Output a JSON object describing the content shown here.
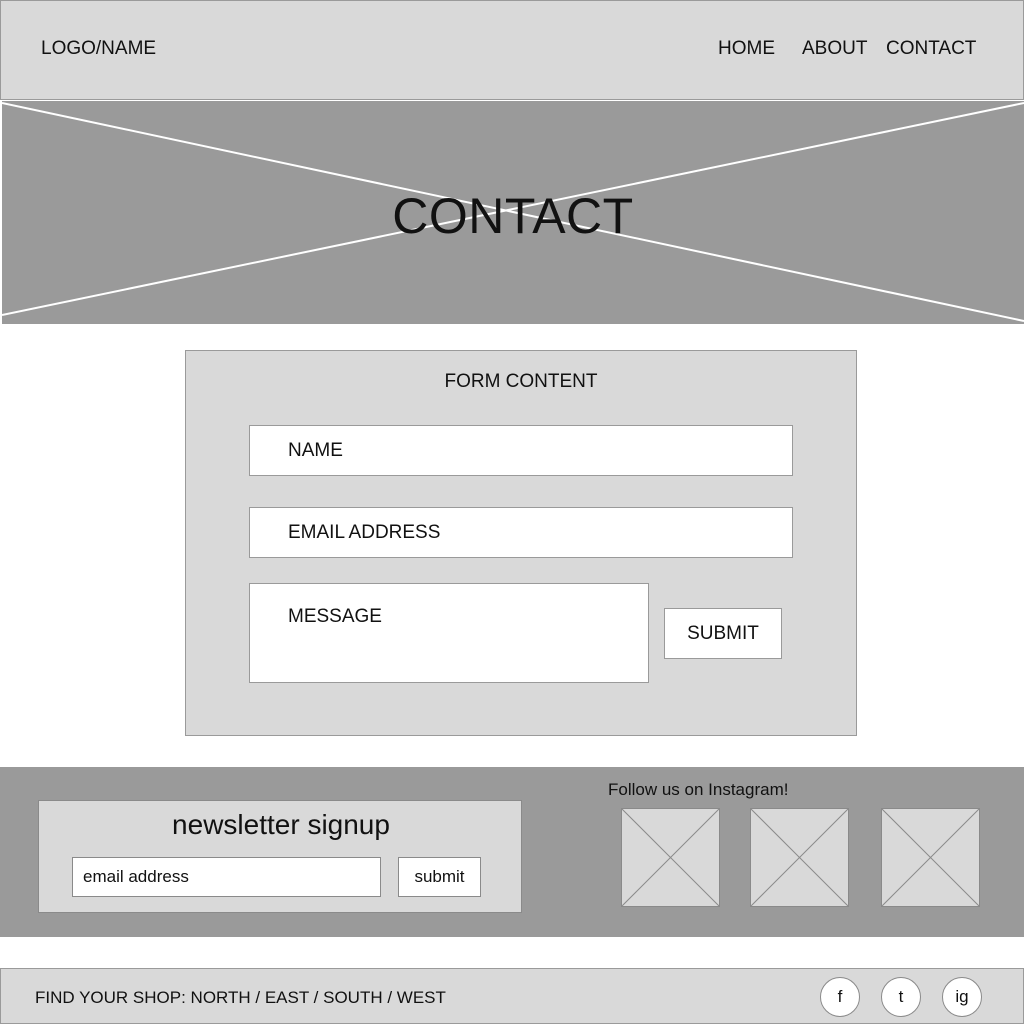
{
  "header": {
    "logo": "LOGO/NAME",
    "nav": {
      "home": "HOME",
      "about": "ABOUT",
      "contact": "CONTACT"
    }
  },
  "hero": {
    "title": "CONTACT",
    "image_icon": "image-placeholder-icon"
  },
  "form": {
    "title": "FORM CONTENT",
    "name_placeholder": "NAME",
    "email_placeholder": "EMAIL ADDRESS",
    "message_placeholder": "MESSAGE",
    "submit_label": "SUBMIT"
  },
  "newsletter": {
    "title": "newsletter signup",
    "email_placeholder": "email address",
    "submit_label": "submit"
  },
  "instagram": {
    "title": "Follow us on Instagram!",
    "images": [
      "image-placeholder-icon",
      "image-placeholder-icon",
      "image-placeholder-icon"
    ]
  },
  "footer": {
    "shop_text": "FIND YOUR SHOP: NORTH / EAST / SOUTH / WEST",
    "social": {
      "facebook": "f",
      "twitter": "t",
      "instagram": "ig"
    }
  },
  "colors": {
    "light_gray": "#d9d9d9",
    "mid_gray": "#9a9a9a",
    "white": "#ffffff"
  }
}
